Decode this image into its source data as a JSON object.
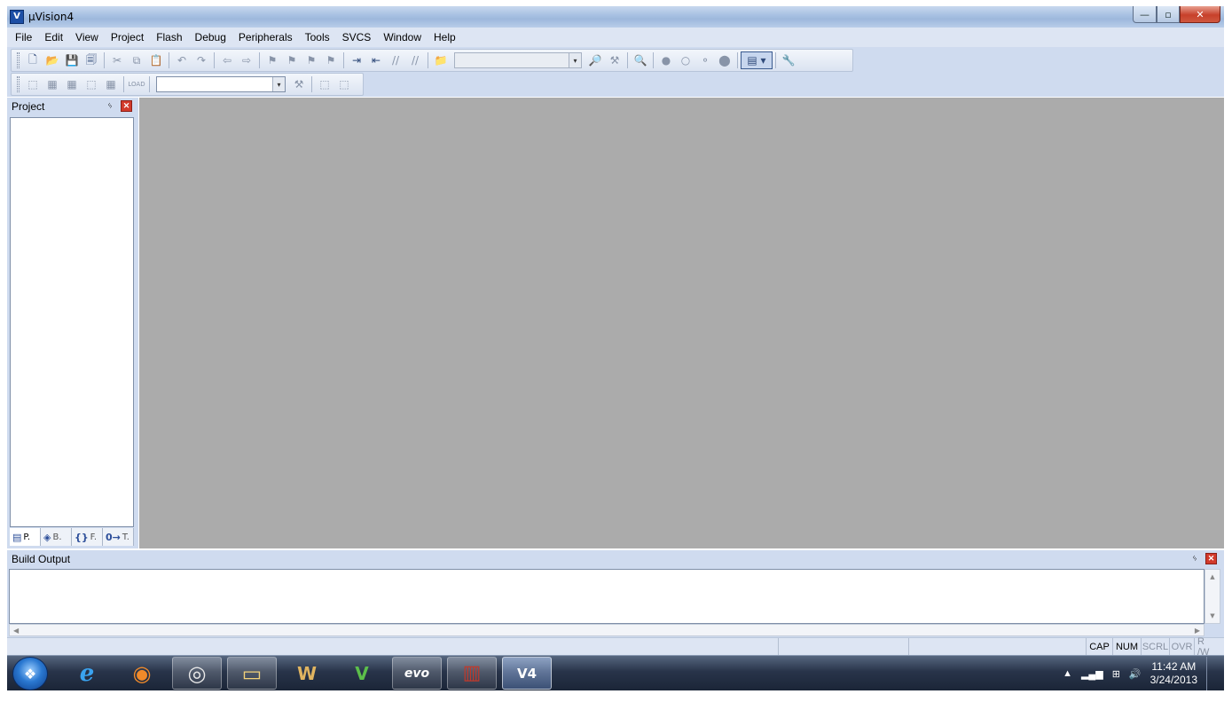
{
  "window": {
    "title": "µVision4",
    "app_icon": "V",
    "min_glyph": "—",
    "max_glyph": "▫",
    "close_glyph": "✕"
  },
  "menu": [
    "File",
    "Edit",
    "View",
    "Project",
    "Flash",
    "Debug",
    "Peripherals",
    "Tools",
    "SVCS",
    "Window",
    "Help"
  ],
  "toolbar1": {
    "new": "🗋",
    "open": "📂",
    "save": "💾",
    "save_all": "🗐",
    "cut": "✂",
    "copy": "⧉",
    "paste": "📋",
    "undo": "↶",
    "redo": "↷",
    "nav_back": "⇦",
    "nav_fwd": "⇨",
    "bm1": "⚑",
    "bm2": "⚑",
    "bm3": "⚑",
    "bm4": "⚑",
    "indent": "⇥",
    "unindent": "⇤",
    "comment": "//",
    "uncomment": "//",
    "find_files": "📁",
    "find": "🔎",
    "find2": "⚒",
    "incr": "🔍",
    "bp1": "●",
    "bp2": "○",
    "bp3": "⚬",
    "bp4": "⬤",
    "window_sel": "▤ ▾",
    "config": "🔧",
    "combo_arrow": "▾"
  },
  "toolbar2": {
    "translate": "⬚",
    "build": "▦",
    "rebuild": "▦",
    "batch": "⬚",
    "stop": "▦",
    "load": "LOAD",
    "target_arrow": "▾",
    "options": "⚒",
    "manage1": "⬚",
    "manage2": "⬚"
  },
  "project_panel": {
    "title": "Project",
    "pin": "ᛃ",
    "close": "✕",
    "tabs": [
      {
        "icon": "▤",
        "label": "P."
      },
      {
        "icon": "◈",
        "label": "B."
      },
      {
        "icon": "{}",
        "label": "F."
      },
      {
        "icon": "0→",
        "label": "T."
      }
    ]
  },
  "build_output": {
    "title": "Build Output",
    "pin": "ᛃ",
    "close": "✕",
    "up": "▲",
    "down": "▼",
    "left": "◀",
    "right": "▶"
  },
  "status": {
    "cap": "CAP",
    "num": "NUM",
    "scrl": "SCRL",
    "ovr": "OVR",
    "rw": "R /W"
  },
  "taskbar": {
    "start": "❖",
    "apps": [
      {
        "name": "ie",
        "glyph": "e",
        "color": "#3aa3f0"
      },
      {
        "name": "firefox",
        "glyph": "◉",
        "color": "#f08a2a"
      },
      {
        "name": "chrome",
        "glyph": "◎",
        "color": "#e8e8e8"
      },
      {
        "name": "explorer",
        "glyph": "▭",
        "color": "#f3d27a"
      },
      {
        "name": "word",
        "glyph": "W",
        "color": "#e0b460"
      },
      {
        "name": "vim",
        "glyph": "V",
        "color": "#5cbf4a"
      },
      {
        "name": "evo",
        "glyph": "evo",
        "color": "#ffffff"
      },
      {
        "name": "winrar",
        "glyph": "▥",
        "color": "#c0392b"
      },
      {
        "name": "uvision",
        "glyph": "V4",
        "color": "#ffffff"
      }
    ],
    "tray_up": "▲",
    "signal": "▂▄▆",
    "network": "⊞",
    "volume": "🔊",
    "time": "11:42 AM",
    "date": "3/24/2013"
  }
}
